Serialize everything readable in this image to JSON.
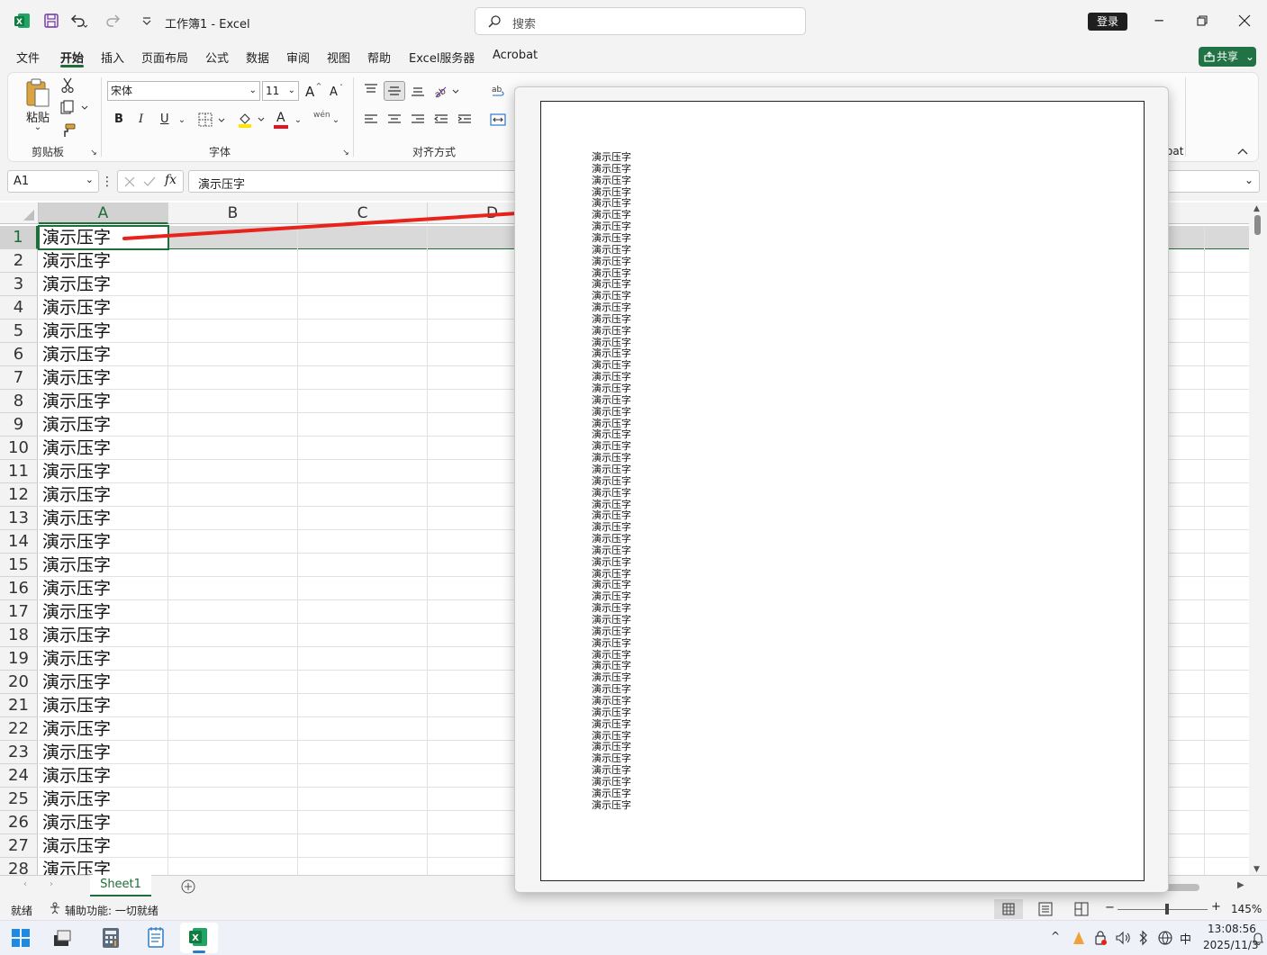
{
  "app": {
    "title": "工作簿1 - Excel"
  },
  "search": {
    "placeholder": "搜索"
  },
  "title_buttons": {
    "login": "登录"
  },
  "menu_tabs": [
    "文件",
    "开始",
    "插入",
    "页面布局",
    "公式",
    "数据",
    "审阅",
    "视图",
    "帮助",
    "Excel服务器",
    "Acrobat"
  ],
  "share": {
    "label": "共享"
  },
  "ribbon": {
    "clipboard": {
      "paste_label": "粘贴",
      "group_label": "剪贴板"
    },
    "font": {
      "font_name": "宋体",
      "font_size": "11",
      "group_label": "字体",
      "bold": "B",
      "italic": "I",
      "underline": "U",
      "grow": "A",
      "shrink": "A",
      "font_color_letter": "A",
      "phonetic": "wén"
    },
    "alignment": {
      "group_label": "对齐方式"
    },
    "right_fragment": "oat"
  },
  "formula_bar": {
    "name_box": "A1",
    "value": "演示压字"
  },
  "grid": {
    "columns": [
      "A",
      "B",
      "C",
      "D"
    ],
    "rows": [
      "1",
      "2",
      "3",
      "4",
      "5",
      "6",
      "7",
      "8",
      "9",
      "10",
      "11",
      "12",
      "13",
      "14",
      "15",
      "16",
      "17",
      "18",
      "19",
      "20",
      "21",
      "22",
      "23",
      "24",
      "25",
      "26",
      "27",
      "28"
    ],
    "cell_text": "演示压字"
  },
  "sheets": {
    "active": "Sheet1"
  },
  "status": {
    "ready": "就绪",
    "accessibility": "辅助功能: 一切就绪",
    "zoom": "145%"
  },
  "taskbar": {
    "time": "13:08:56",
    "date": "2025/11/3",
    "ime": "中"
  },
  "preview": {
    "line_text": "演示压字",
    "line_count": 57
  },
  "colors": {
    "accent": "#217346",
    "arrow": "#e8231c",
    "selection": "#d9d9d9"
  }
}
